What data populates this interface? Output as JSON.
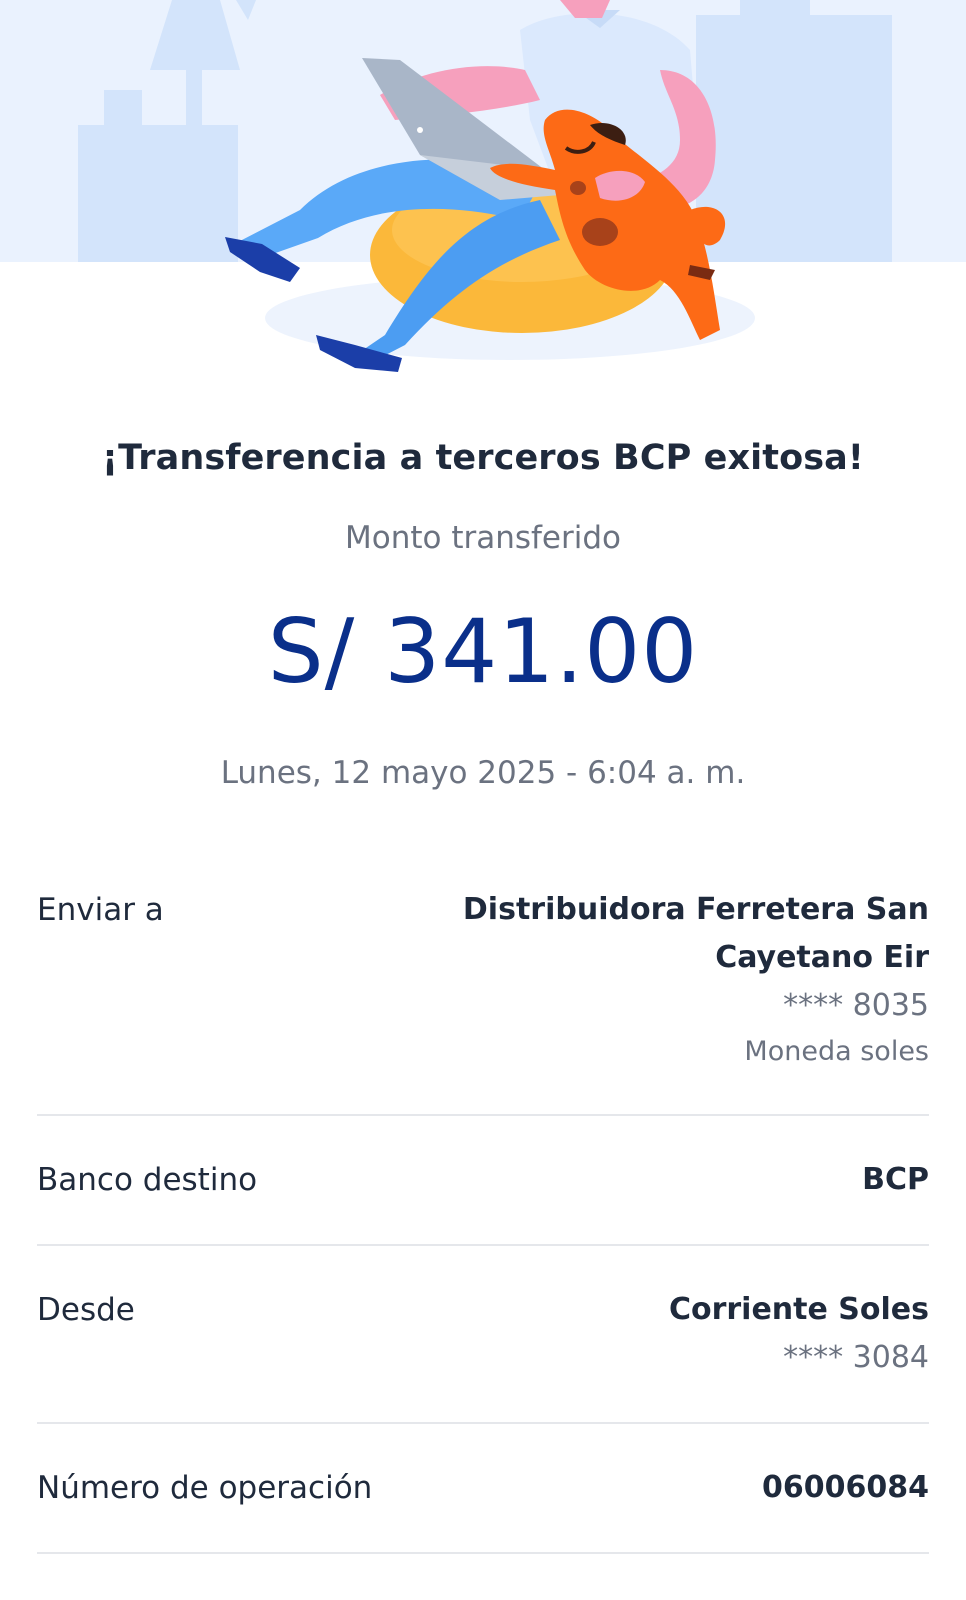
{
  "header": {
    "title": "¡Transferencia a terceros BCP exitosa!",
    "subtitle": "Monto transferido",
    "amount": "S/ 341.00",
    "datetime": "Lunes, 12 mayo 2025 - 6:04 a. m."
  },
  "details": {
    "enviar_a": {
      "label": "Enviar a",
      "name_line1": "Distribuidora Ferretera San",
      "name_line2": "Cayetano Eir",
      "account": "**** 8035",
      "currency": "Moneda soles"
    },
    "banco_destino": {
      "label": "Banco destino",
      "value": "BCP"
    },
    "desde": {
      "label": "Desde",
      "account_type": "Corriente Soles",
      "account": "**** 3084"
    },
    "numero_operacion": {
      "label": "Número de operación",
      "value": "06006084"
    }
  },
  "colors": {
    "amount": "#0a2f8a",
    "text": "#1f2a3c",
    "muted": "#6b7280",
    "divider": "#e5e7eb",
    "hero_bg": "#eaf2fe"
  },
  "illustration": "person-with-laptop-and-dog"
}
